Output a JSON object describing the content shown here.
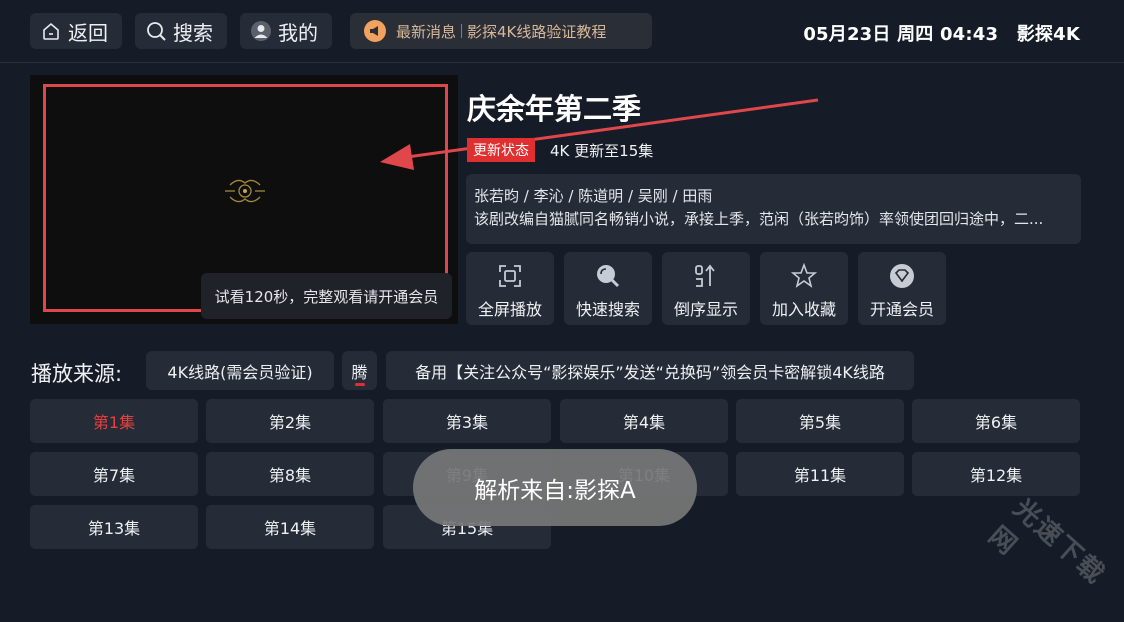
{
  "topbar": {
    "back_label": "返回",
    "search_label": "搜索",
    "profile_label": "我的",
    "notice_title": "最新消息",
    "notice_text": "影探4K线路验证教程",
    "datetime": "05月23日 周四 04:43",
    "app_name": "影探4K"
  },
  "player": {
    "trial_text": "试看120秒，完整观看请开通会员"
  },
  "show": {
    "title": "庆余年第二季",
    "status_label": "更新状态",
    "update_text": "4K 更新至15集",
    "cast": "张若昀 / 李沁 / 陈道明 / 吴刚 / 田雨",
    "synopsis": "该剧改编自猫腻同名畅销小说，承接上季，范闲（张若昀饰）率领使团回归途中，二..."
  },
  "actions": [
    {
      "label": "全屏播放",
      "icon": "fullscreen-icon"
    },
    {
      "label": "快速搜索",
      "icon": "search-icon"
    },
    {
      "label": "倒序显示",
      "icon": "sort-icon"
    },
    {
      "label": "加入收藏",
      "icon": "star-icon"
    },
    {
      "label": "开通会员",
      "icon": "vip-icon"
    }
  ],
  "sources": {
    "label": "播放来源:",
    "items": [
      "4K线路(需会员验证)",
      "腾",
      "备用【关注公众号“影探娱乐”发送“兑换码”领会员卡密解锁4K线路"
    ]
  },
  "episodes": [
    "第1集",
    "第2集",
    "第3集",
    "第4集",
    "第5集",
    "第6集",
    "第7集",
    "第8集",
    "第9集",
    "第10集",
    "第11集",
    "第12集",
    "第13集",
    "第14集",
    "第15集"
  ],
  "active_episode": 0,
  "toast": "解析来自:影探A",
  "watermark": "光速下载网",
  "colors": {
    "background": "#161c27",
    "card": "#252b37",
    "accent_red": "#e02f31",
    "frame_red": "#e0474b"
  }
}
